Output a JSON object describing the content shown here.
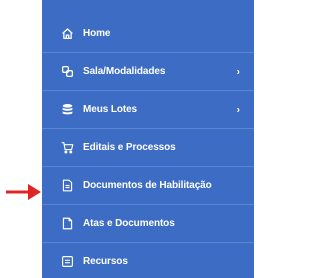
{
  "sidebar": {
    "background": "#3d6cc4",
    "items": [
      {
        "label": "Home",
        "icon": "home-icon",
        "has_submenu": false
      },
      {
        "label": "Sala/Modalidades",
        "icon": "link-icon",
        "has_submenu": true
      },
      {
        "label": "Meus Lotes",
        "icon": "database-icon",
        "has_submenu": true
      },
      {
        "label": "Editais e Processos",
        "icon": "cart-icon",
        "has_submenu": false
      },
      {
        "label": "Documentos de Habilitação",
        "icon": "document-icon",
        "has_submenu": false
      },
      {
        "label": "Atas e Documentos",
        "icon": "file-icon",
        "has_submenu": false
      },
      {
        "label": "Recursos",
        "icon": "list-icon",
        "has_submenu": false
      }
    ],
    "chevron": "›"
  },
  "annotation": {
    "arrow_color": "#e02424",
    "points_to": "Documentos de Habilitação"
  }
}
